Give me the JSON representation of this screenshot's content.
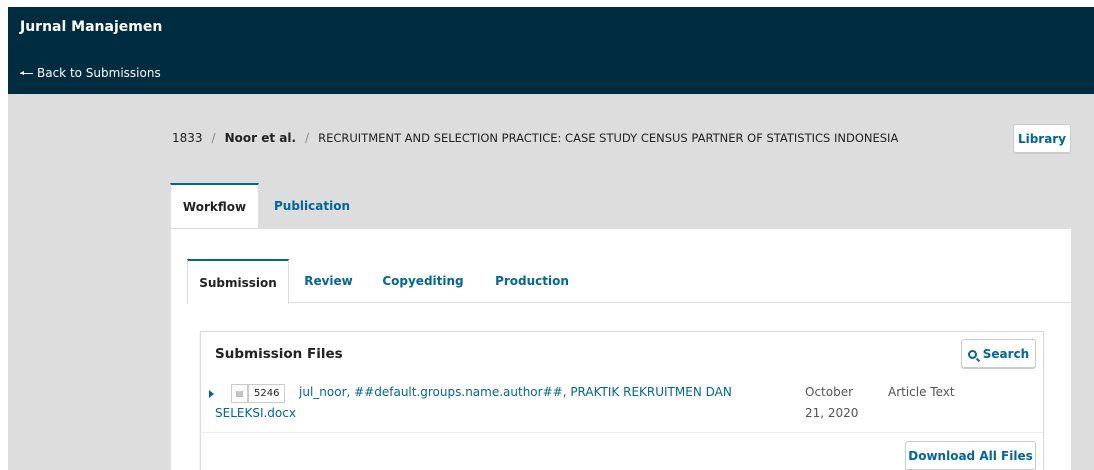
{
  "header": {
    "journal_title": "Jurnal Manajemen",
    "back_link": "Back to Submissions"
  },
  "breadcrumb": {
    "id": "1833",
    "authors": "Noor et al.",
    "title": "RECRUITMENT AND SELECTION PRACTICE: CASE STUDY CENSUS PARTNER OF STATISTICS INDONESIA",
    "separator": "/"
  },
  "library_button": "Library",
  "tabs": [
    {
      "label": "Workflow",
      "active": true
    },
    {
      "label": "Publication",
      "active": false
    }
  ],
  "subtabs": [
    {
      "label": "Submission",
      "active": true
    },
    {
      "label": "Review",
      "active": false
    },
    {
      "label": "Copyediting",
      "active": false
    },
    {
      "label": "Production",
      "active": false
    }
  ],
  "submission_files": {
    "heading": "Submission Files",
    "search_label": "Search",
    "files": [
      {
        "id": "5246",
        "name": "jul_noor, ##default.groups.name.author##, PRAKTIK REKRUITMEN DAN SELEKSI.docx",
        "date": "October 21, 2020",
        "type": "Article Text"
      }
    ],
    "download_all_label": "Download All Files"
  },
  "colors": {
    "header_bg": "#002c40",
    "accent": "#006798",
    "page_bg": "#dddddd"
  }
}
